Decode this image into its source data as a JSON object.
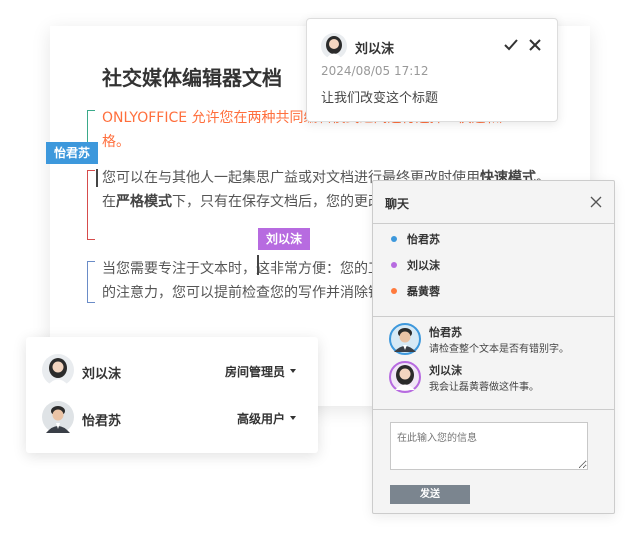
{
  "document": {
    "title": "社交媒体编辑器文档",
    "p1": "ONLYOFFICE 允许您在两种共同编辑模式之间进行选择：快速和严格。",
    "p2_a": "您可以在与其他人一起集思广益或对文档进行最终更改时使用",
    "p2_b": "快速模式",
    "p2_c": "。在",
    "p2_d": "严格模式",
    "p2_e": "下，只有在保存文档后，您的更改才会对其他共同编辑者。",
    "p3": "当您需要专注于文本时，这非常方便：您的工作不会分散共同编辑者的注意力，您可以提前检查您的写作并消除错误。",
    "cursor_tags": [
      "怡君苏",
      "刘以沫"
    ]
  },
  "comment": {
    "author": "刘以沫",
    "date": "2024/08/05 17:12",
    "text": "让我们改变这个标题"
  },
  "chat": {
    "title": "聊天",
    "users": [
      {
        "name": "怡君苏",
        "color": "#3d98dc"
      },
      {
        "name": "刘以沫",
        "color": "#b76be0"
      },
      {
        "name": "磊黄蓉",
        "color": "#ff7a3d"
      }
    ],
    "messages": [
      {
        "name": "怡君苏",
        "text": "请检查整个文本是否有错别字。"
      },
      {
        "name": "刘以沫",
        "text": "我会让磊黄蓉做这件事。"
      }
    ],
    "input_placeholder": "在此输入您的信息",
    "send_label": "发送"
  },
  "users_panel": [
    {
      "name": "刘以沫",
      "role": "房间管理员"
    },
    {
      "name": "怡君苏",
      "role": "高级用户"
    }
  ],
  "colors": {
    "accent_orange": "#ff6f3d",
    "tag_blue": "#3d98dc",
    "tag_purple": "#b76be0"
  },
  "icons": [
    "check-icon",
    "close-icon",
    "female-avatar",
    "male-avatar",
    "chevron-down-icon"
  ]
}
